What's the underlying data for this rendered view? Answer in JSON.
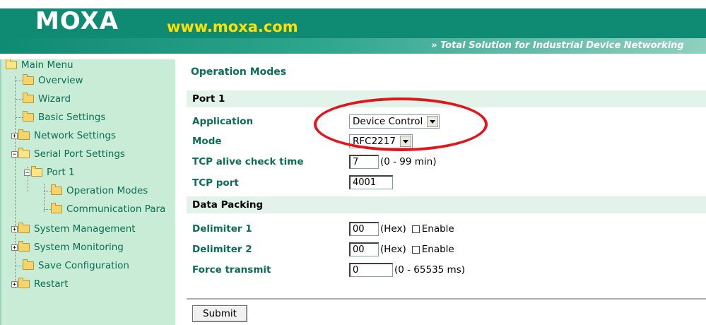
{
  "header": {
    "logo": "MOXA",
    "url": "www.moxa.com",
    "tagline": "»  Total Solution for Industrial Device Networking"
  },
  "sidebar": {
    "items": [
      {
        "label": "Main Menu"
      },
      {
        "label": "Overview"
      },
      {
        "label": "Wizard"
      },
      {
        "label": "Basic Settings"
      },
      {
        "label": "Network Settings"
      },
      {
        "label": "Serial Port Settings"
      },
      {
        "label": "Port 1"
      },
      {
        "label": "Operation Modes"
      },
      {
        "label": "Communication Para"
      },
      {
        "label": "System Management"
      },
      {
        "label": "System Monitoring"
      },
      {
        "label": "Save Configuration"
      },
      {
        "label": "Restart"
      }
    ]
  },
  "main": {
    "title": "Operation Modes",
    "port_section": "Port 1",
    "application": {
      "label": "Application",
      "value": "Device Control"
    },
    "mode": {
      "label": "Mode",
      "value": "RFC2217"
    },
    "tcp_alive": {
      "label": "TCP alive check time",
      "value": "7",
      "range": "(0 - 99 min)"
    },
    "tcp_port": {
      "label": "TCP port",
      "value": "4001"
    },
    "data_packing_section": "Data Packing",
    "delimiter1": {
      "label": "Delimiter 1",
      "value": "00",
      "unit": "(Hex)",
      "enable": "Enable"
    },
    "delimiter2": {
      "label": "Delimiter 2",
      "value": "00",
      "unit": "(Hex)",
      "enable": "Enable"
    },
    "force_transmit": {
      "label": "Force transmit",
      "value": "0",
      "range": "(0 - 65535 ms)"
    },
    "submit": "Submit"
  },
  "colors": {
    "brand_teal": "#0f8a73",
    "url_yellow": "#ffe000",
    "sidebar_bg": "#c8ecd6",
    "label_green": "#0a6e55",
    "highlight_red": "#e4141b"
  }
}
